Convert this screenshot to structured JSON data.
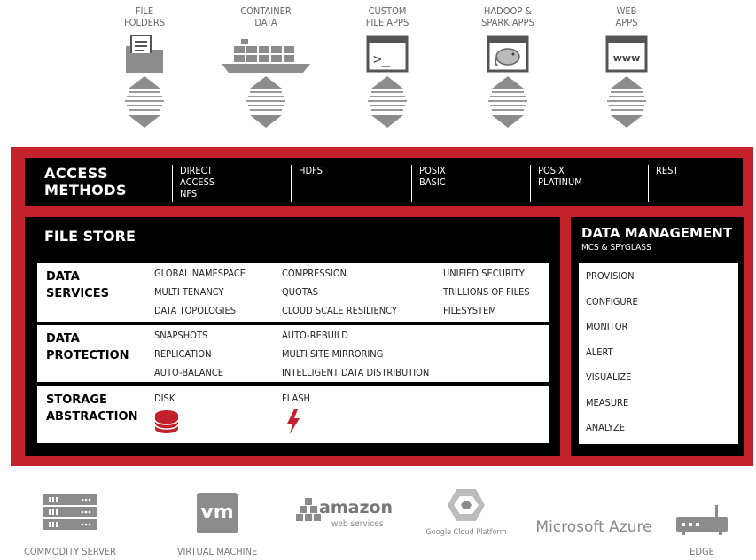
{
  "top_sources": [
    {
      "label": "FILE\nFOLDERS",
      "icon": "folder-document-icon"
    },
    {
      "label": "CONTAINER\nDATA",
      "icon": "container-ship-icon"
    },
    {
      "label": "CUSTOM\nFILE APPS",
      "icon": "terminal-window-icon",
      "glyph": ">_"
    },
    {
      "label": "HADOOP &\nSPARK APPS",
      "icon": "hadoop-elephant-icon"
    },
    {
      "label": "WEB\nAPPS",
      "icon": "web-browser-icon",
      "glyph": "www"
    }
  ],
  "access": {
    "title": "ACCESS\nMETHODS",
    "items": [
      "DIRECT\nACCESS\nNFS",
      "HDFS",
      "POSIX\nBASIC",
      "POSIX\nPLATINUM",
      "REST"
    ]
  },
  "file_store": {
    "title": "FILE STORE",
    "data_services": {
      "title": "DATA\nSERVICES",
      "col1": [
        "GLOBAL NAMESPACE",
        "MULTI TENANCY",
        "DATA TOPOLOGIES"
      ],
      "col2": [
        "COMPRESSION",
        "QUOTAS",
        "CLOUD SCALE RESILIENCY"
      ],
      "col3": [
        "UNIFIED SECURITY",
        "TRILLIONS OF FILES",
        "FILESYSTEM"
      ]
    },
    "data_protection": {
      "title": "DATA\nPROTECTION",
      "col1": [
        "SNAPSHOTS",
        "REPLICATION",
        "AUTO-BALANCE"
      ],
      "col2": [
        "AUTO-REBUILD",
        "MULTI SITE MIRRORING",
        "INTELLIGENT DATA DISTRIBUTION"
      ]
    },
    "storage_abstraction": {
      "title": "STORAGE\nABSTRACTION",
      "disk": "DISK",
      "flash": "FLASH"
    }
  },
  "data_management": {
    "title": "DATA MANAGEMENT",
    "subtitle": "MCS & SPYGLASS",
    "items": [
      "PROVISION",
      "CONFIGURE",
      "MONITOR",
      "ALERT",
      "VISUALIZE",
      "MEASURE",
      "ANALYZE"
    ]
  },
  "platforms": {
    "commodity_server": "COMMODITY SERVER",
    "virtual_machine": "VIRTUAL MACHINE",
    "vm_logo": "vm",
    "amazon": "amazon",
    "amazon_sub": "web services",
    "google": "Google Cloud Platform",
    "azure": "Microsoft Azure",
    "edge": "EDGE"
  },
  "colors": {
    "accent_red": "#c3222d",
    "panel_black": "#000000",
    "icon_gray": "#8c8c8c"
  }
}
